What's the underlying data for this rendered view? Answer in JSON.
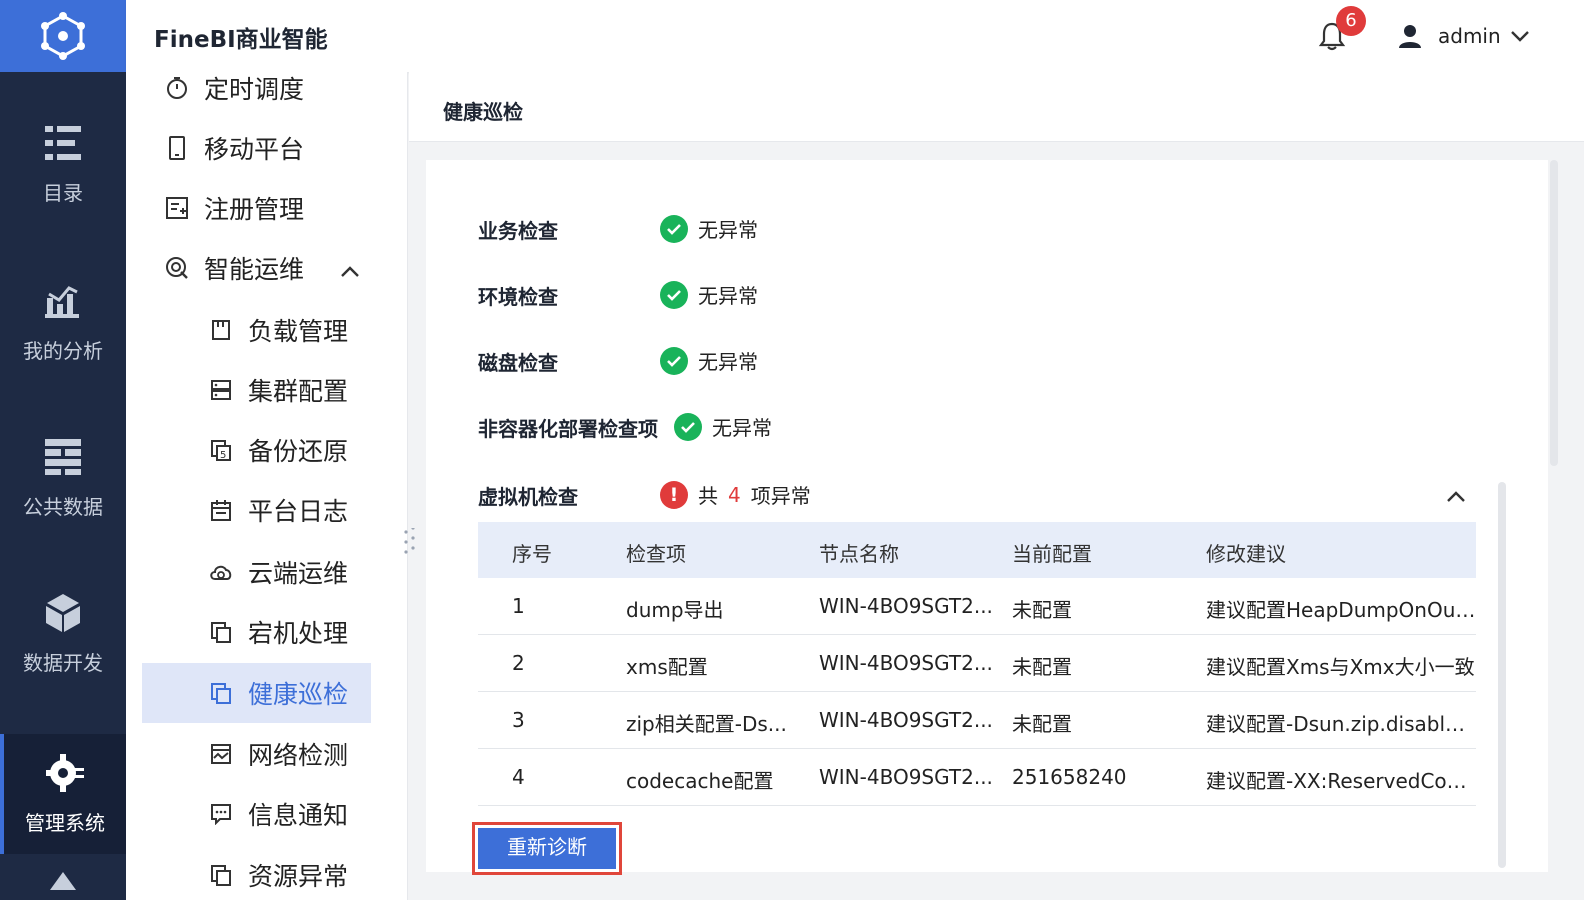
{
  "app": {
    "brand": "FineBI商业智能"
  },
  "header": {
    "notification_count": "6",
    "username": "admin"
  },
  "rail": {
    "items": [
      {
        "label": "目录",
        "icon": "catalog-icon"
      },
      {
        "label": "我的分析",
        "icon": "analysis-icon"
      },
      {
        "label": "公共数据",
        "icon": "public-data-icon"
      },
      {
        "label": "数据开发",
        "icon": "data-dev-icon"
      },
      {
        "label": "管理系统",
        "icon": "system-manage-icon",
        "active": true
      }
    ]
  },
  "subnav": {
    "items": [
      {
        "label": "定时调度",
        "icon": "timer-icon"
      },
      {
        "label": "移动平台",
        "icon": "mobile-icon"
      },
      {
        "label": "注册管理",
        "icon": "register-icon"
      },
      {
        "label": "智能运维",
        "icon": "ops-icon",
        "expanded": true
      },
      {
        "label": "负载管理",
        "icon": "load-icon"
      },
      {
        "label": "集群配置",
        "icon": "cluster-icon"
      },
      {
        "label": "备份还原",
        "icon": "backup-icon"
      },
      {
        "label": "平台日志",
        "icon": "calendar-icon"
      },
      {
        "label": "云端运维",
        "icon": "cloud-icon"
      },
      {
        "label": "宕机处理",
        "icon": "copy-icon"
      },
      {
        "label": "健康巡检",
        "icon": "copy-icon",
        "selected": true
      },
      {
        "label": "网络检测",
        "icon": "network-icon"
      },
      {
        "label": "信息通知",
        "icon": "message-icon"
      },
      {
        "label": "资源异常",
        "icon": "copy-icon"
      }
    ]
  },
  "main": {
    "title": "健康巡检",
    "checks": [
      {
        "label": "业务检查",
        "status": "无异常"
      },
      {
        "label": "环境检查",
        "status": "无异常"
      },
      {
        "label": "磁盘检查",
        "status": "无异常"
      },
      {
        "label": "非容器化部署检查项",
        "status": "无异常"
      }
    ],
    "vm_check": {
      "label": "虚拟机检查",
      "prefix": "共",
      "count": "4",
      "suffix": "项异常"
    },
    "table": {
      "headers": [
        "序号",
        "检查项",
        "节点名称",
        "当前配置",
        "修改建议"
      ],
      "rows": [
        [
          "1",
          "dump导出",
          "WIN-4BO9SGT2...",
          "未配置",
          "建议配置HeapDumpOnOut..."
        ],
        [
          "2",
          "xms配置",
          "WIN-4BO9SGT2...",
          "未配置",
          "建议配置Xms与Xmx大小一致"
        ],
        [
          "3",
          "zip相关配置-Ds...",
          "WIN-4BO9SGT2...",
          "未配置",
          "建议配置-Dsun.zip.disable..."
        ],
        [
          "4",
          "codecache配置",
          "WIN-4BO9SGT2...",
          "251658240",
          "建议配置-XX:ReservedCod..."
        ]
      ]
    },
    "rediagnose_label": "重新诊断"
  },
  "colors": {
    "accent": "#3d6fd8",
    "rail_bg": "#1e2a44",
    "ok": "#19b35a",
    "error": "#e03b3b"
  }
}
